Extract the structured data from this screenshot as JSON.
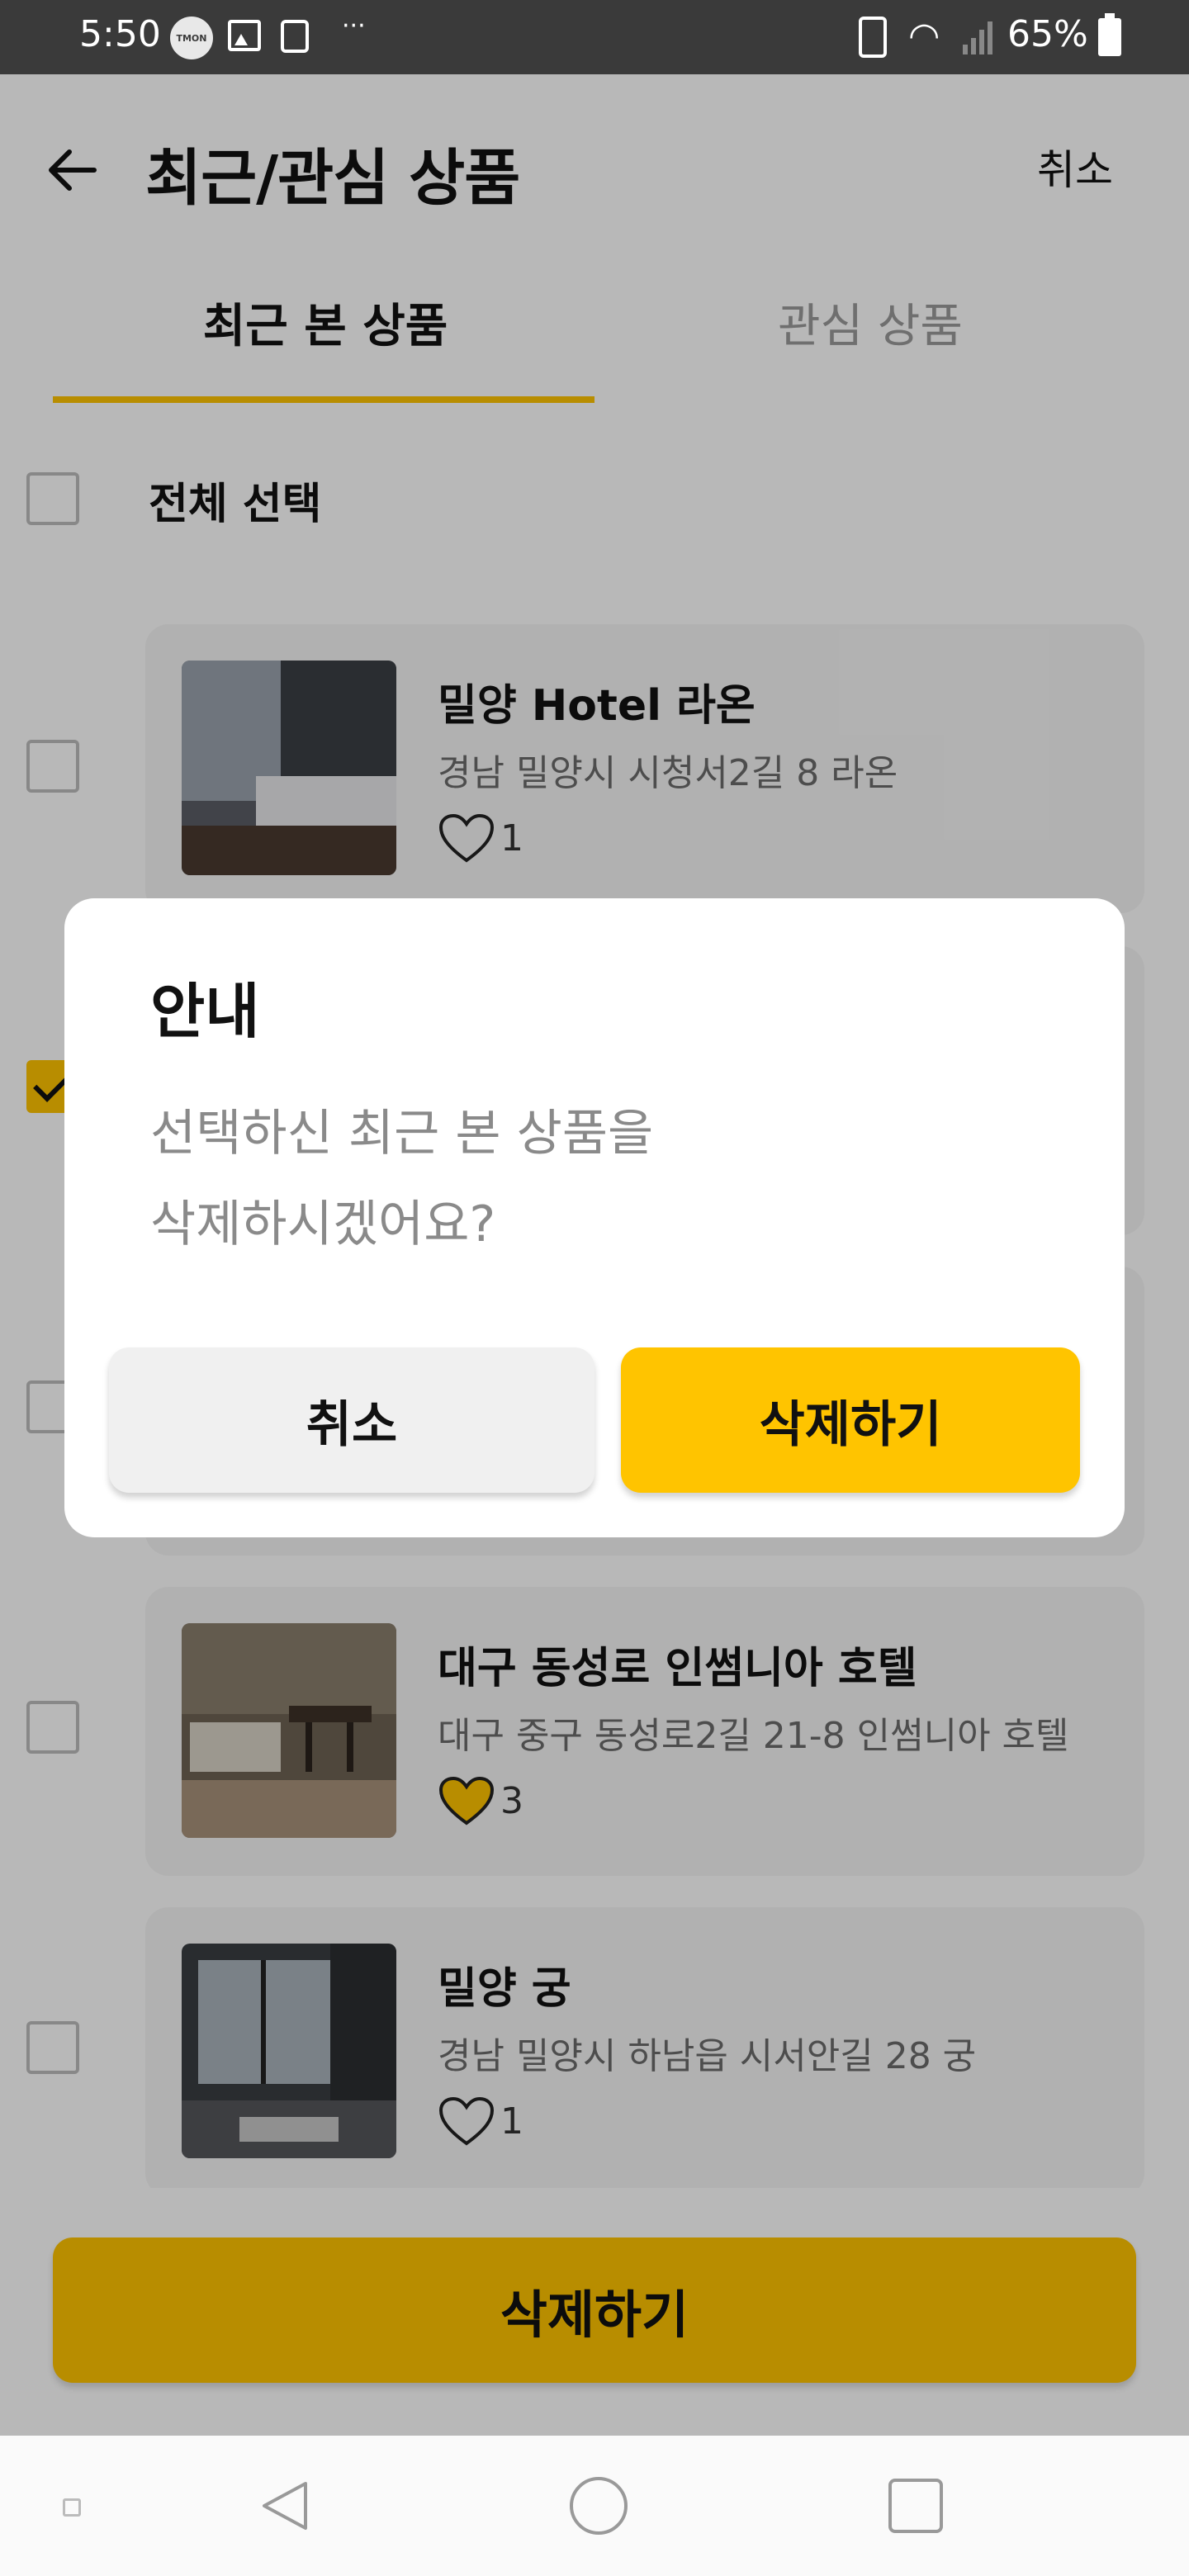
{
  "status_bar": {
    "time": "5:50",
    "tmon": "TMON",
    "dots": "···",
    "battery": "65%"
  },
  "header": {
    "title": "최근/관심 상품",
    "cancel": "취소",
    "tabs": [
      "최근 본 상품",
      "관심 상품"
    ]
  },
  "list": {
    "select_all": "전체 선택",
    "items": [
      {
        "name": "밀양 Hotel 라온",
        "address": "경남 밀양시 시청서2길 8 라온",
        "likes": "1",
        "liked": false,
        "checked": false
      },
      {
        "name": "",
        "address": "",
        "likes": "",
        "liked": false,
        "checked": true
      },
      {
        "name": "",
        "address": "",
        "likes": "",
        "liked": false,
        "checked": false
      },
      {
        "name": "대구 동성로 인썸니아 호텔",
        "address": "대구 중구 동성로2길 21-8 인썸니아 호텔",
        "likes": "3",
        "liked": true,
        "checked": false
      },
      {
        "name": "밀양 궁",
        "address": "경남 밀양시 하남읍 시서안길 28 궁",
        "likes": "1",
        "liked": false,
        "checked": false
      }
    ]
  },
  "bottom": {
    "delete": "삭제하기"
  },
  "dialog": {
    "title": "안내",
    "message": [
      "선택하신 최근 본 상품을",
      "삭제하시겠어요?"
    ],
    "cancel": "취소",
    "confirm": "삭제하기"
  },
  "colors": {
    "accent": "#ffc400",
    "overlay": "rgba(0,0,0,0.28)"
  },
  "icons": [
    "back-arrow-icon",
    "heart-icon",
    "checkbox-icon",
    "nav-back-icon",
    "nav-home-icon",
    "nav-recents-icon"
  ]
}
